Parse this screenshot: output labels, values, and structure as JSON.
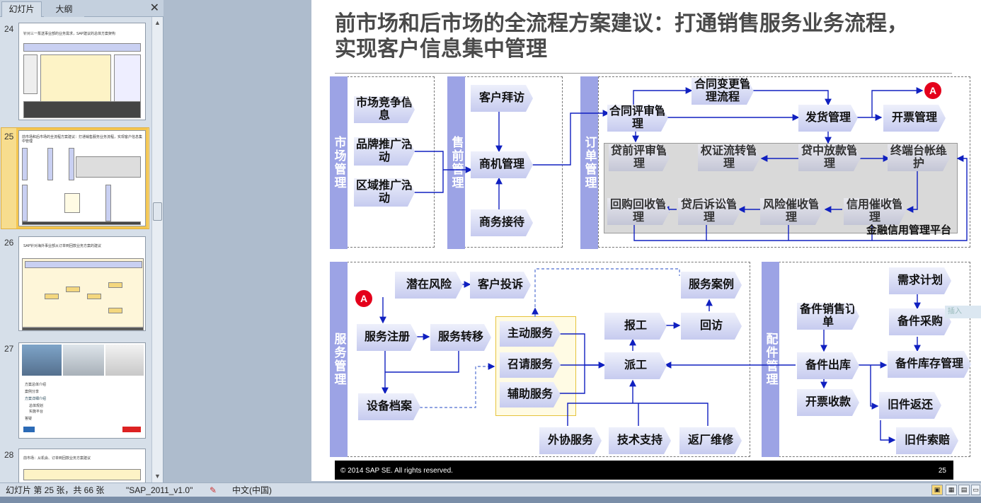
{
  "left_pane": {
    "tabs": [
      "幻灯片",
      "大纲"
    ],
    "close_glyph": "✕",
    "thumbnails": [
      {
        "num": "24",
        "caption": "针对三一泵送事业部的业务需求，SAP建议的总体方案架构"
      },
      {
        "num": "25",
        "caption": "前市场和后市场的全流程方案建议：打通销售服务业务流程，实现客户信息集中管理"
      },
      {
        "num": "26",
        "caption": "SAP针对海外事业部从订单到回款业务方案的建议"
      },
      {
        "num": "27",
        "caption": "",
        "bullets": [
          "方案总体介绍",
          "案例分享",
          "方案详细介绍",
          "总体规划",
          "实施平台",
          "答疑"
        ]
      },
      {
        "num": "28",
        "caption": "前市场：从机会、订单到回款业务方案建议"
      }
    ]
  },
  "slide": {
    "title_line1": "前市场和后市场的全流程方案建议：打通销售服务业务流程，",
    "title_line2": "实现客户信息集中管理",
    "footer_copyright": "©  2014 SAP SE.  All rights reserved.",
    "footer_page": "25",
    "sidebars": {
      "market": "市场管理",
      "presales": "售前管理",
      "order": "订单管理",
      "service": "服务管理",
      "parts": "配件管理"
    },
    "market_nodes": [
      "市场竞争信息",
      "品牌推广活动",
      "区域推广活动"
    ],
    "presales_nodes": [
      "客户拜访",
      "商机管理",
      "商务接待"
    ],
    "order_nodes": {
      "contract_review": "合同评审管理",
      "contract_change": "合同变更管理流程",
      "delivery": "发货管理",
      "invoice": "开票管理",
      "pre_loan": "贷前评审管理",
      "rights_transfer": "权证流转管理",
      "in_loan": "贷中放款管理",
      "terminal_ledger": "终端台帐维护",
      "buyback": "回购回收管理",
      "post_loan": "贷后诉讼管理",
      "risk_collect": "风险催收管理",
      "credit_collect": "信用催收管理",
      "platform": "金融信用管理平台"
    },
    "service_nodes": {
      "latent_risk": "潜在风险",
      "complaint": "客户投诉",
      "case": "服务案例",
      "register": "服务注册",
      "transfer": "服务转移",
      "active": "主动服务",
      "call": "召请服务",
      "aux": "辅助服务",
      "report": "报工",
      "revisit": "回访",
      "dispatch": "派工",
      "archive": "设备档案",
      "outsource": "外协服务",
      "tech": "技术支持",
      "factory": "返厂维修"
    },
    "parts_nodes": {
      "demand": "需求计划",
      "sales_order": "备件销售订单",
      "purchase": "备件采购",
      "outbound": "备件出库",
      "stock": "备件库存管理",
      "invoice": "开票收款",
      "return": "旧件返还",
      "claim": "旧件索赔"
    },
    "badge": "A"
  },
  "right_gutter": "插入",
  "status_bar": {
    "slide_info": "幻灯片 第 25 张，共 66 张",
    "theme": "\"SAP_2011_v1.0\"",
    "language": "中文(中国)"
  }
}
